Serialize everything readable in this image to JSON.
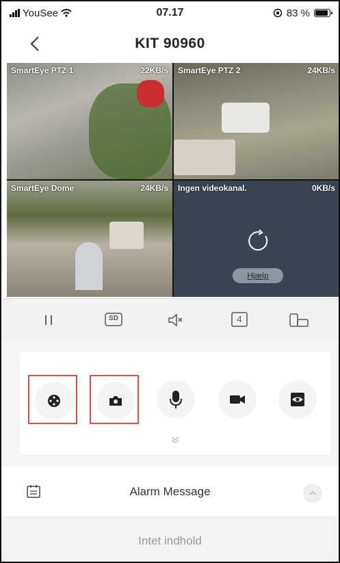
{
  "status_bar": {
    "carrier": "YouSee",
    "time": "07.17",
    "battery": "83 %",
    "battery_level": 0.83
  },
  "header": {
    "title": "KIT 90960"
  },
  "video_grid": {
    "channels": [
      {
        "label": "SmartEye PTZ 1",
        "rate": "22KB/s"
      },
      {
        "label": "SmartEye PTZ 2",
        "rate": "24KB/s"
      },
      {
        "label": "SmartEye Dome",
        "rate": "24KB/s"
      },
      {
        "label": "Ingen videokanal.",
        "rate": "0KB/s",
        "help_label": "Hjælp"
      }
    ]
  },
  "controls": {
    "quality_label": "SD",
    "split_label": "4"
  },
  "actions": [
    {
      "icon": "ptz-control-icon",
      "selected": true
    },
    {
      "icon": "camera-snapshot-icon",
      "selected": true
    },
    {
      "icon": "microphone-icon",
      "selected": false
    },
    {
      "icon": "video-record-icon",
      "selected": false
    },
    {
      "icon": "preset-view-icon",
      "selected": false
    }
  ],
  "alarm": {
    "title": "Alarm Message",
    "empty_text": "Intet indhold"
  },
  "colors": {
    "selection_border": "#e14b4b",
    "empty_channel_bg": "#3a4553"
  }
}
